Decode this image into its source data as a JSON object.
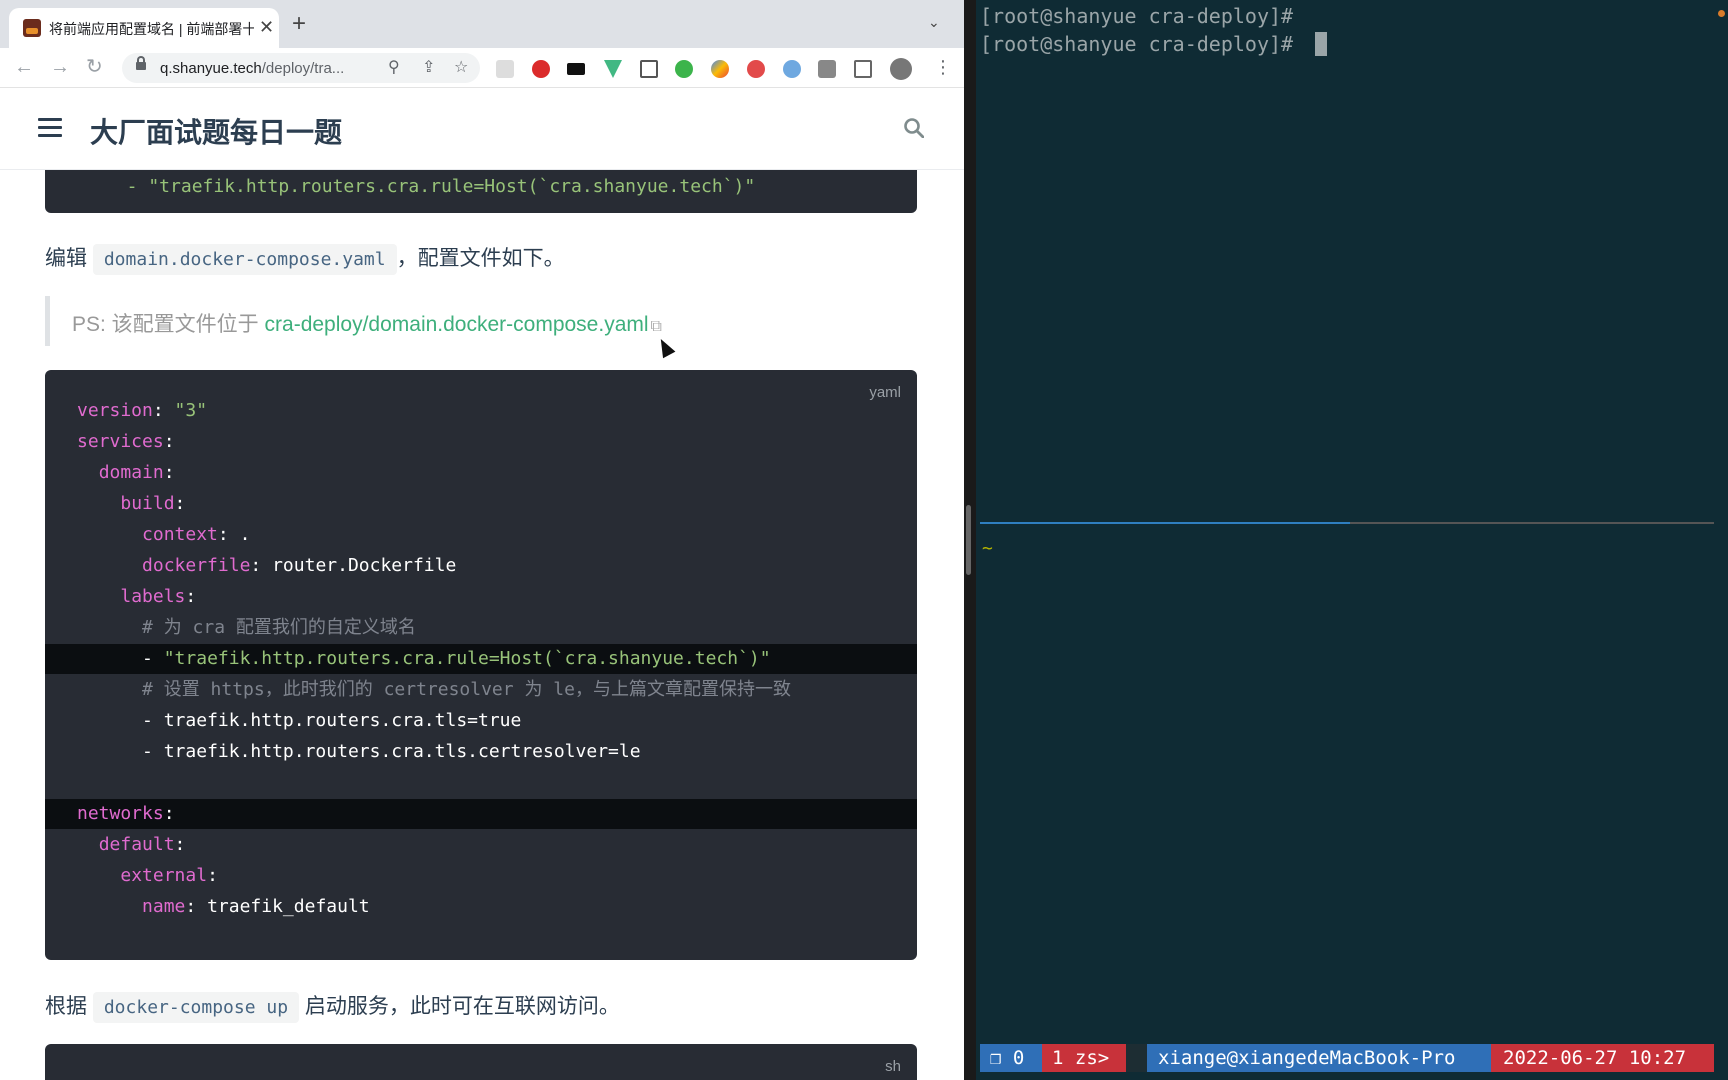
{
  "browser": {
    "tab": {
      "title": "将前端应用配置域名 | 前端部署十",
      "close": "✕"
    },
    "new_tab": "+",
    "tab_menu": "⌄",
    "nav": {
      "back": "←",
      "forward": "→",
      "reload": "↻"
    },
    "url": {
      "host": "q.shanyue.tech",
      "path": "/deploy/tra..."
    },
    "omnibox_icons": {
      "zoom": "⚲",
      "share": "⇪",
      "bookmark": "☆"
    },
    "menu": "⋮"
  },
  "site": {
    "title": "大厂面试题每日一题"
  },
  "article": {
    "top_code_line": "  - \"traefik.http.routers.cra.rule=Host(`cra.shanyue.tech`)\"",
    "para1": {
      "before": "编辑 ",
      "code": "domain.docker-compose.yaml",
      "after": "，配置文件如下。"
    },
    "tip": {
      "prefix": "PS: 该配置文件位于 ",
      "link": "cra-deploy/domain.docker-compose.yaml",
      "external_icon": "⧉"
    },
    "yaml_block": {
      "lang": "yaml",
      "lines": [
        {
          "indent": "",
          "key": "version",
          "sep": ": ",
          "val": "\"3\"",
          "val_type": "s"
        },
        {
          "indent": "",
          "key": "services",
          "sep": ":",
          "val": "",
          "val_type": ""
        },
        {
          "indent": "  ",
          "key": "domain",
          "sep": ":",
          "val": "",
          "val_type": ""
        },
        {
          "indent": "    ",
          "key": "build",
          "sep": ":",
          "val": "",
          "val_type": ""
        },
        {
          "indent": "      ",
          "key": "context",
          "sep": ": ",
          "val": ".",
          "val_type": ""
        },
        {
          "indent": "      ",
          "key": "dockerfile",
          "sep": ": ",
          "val": "router.Dockerfile",
          "val_type": ""
        },
        {
          "indent": "    ",
          "key": "labels",
          "sep": ":",
          "val": "",
          "val_type": ""
        },
        {
          "indent": "      ",
          "key": "",
          "sep": "",
          "val": "# 为 cra 配置我们的自定义域名",
          "val_type": "c"
        },
        {
          "indent": "      ",
          "key": "",
          "sep": "- ",
          "val": "\"traefik.http.routers.cra.rule=Host(`cra.shanyue.tech`)\"",
          "val_type": "s",
          "highlight": true
        },
        {
          "indent": "      ",
          "key": "",
          "sep": "",
          "val": "# 设置 https，此时我们的 certresolver 为 le，与上篇文章配置保持一致",
          "val_type": "c"
        },
        {
          "indent": "      ",
          "key": "",
          "sep": "- ",
          "val": "traefik.http.routers.cra.tls=true",
          "val_type": ""
        },
        {
          "indent": "      ",
          "key": "",
          "sep": "- ",
          "val": "traefik.http.routers.cra.tls.certresolver=le",
          "val_type": ""
        },
        {
          "indent": "",
          "key": "",
          "sep": "",
          "val": "",
          "val_type": ""
        },
        {
          "indent": "",
          "key": "networks",
          "sep": ":",
          "val": "",
          "val_type": "",
          "highlight": true
        },
        {
          "indent": "  ",
          "key": "default",
          "sep": ":",
          "val": "",
          "val_type": ""
        },
        {
          "indent": "    ",
          "key": "external",
          "sep": ":",
          "val": "",
          "val_type": ""
        },
        {
          "indent": "      ",
          "key": "name",
          "sep": ": ",
          "val": "traefik_default",
          "val_type": ""
        }
      ]
    },
    "para2": {
      "before": "根据 ",
      "code": "docker-compose up",
      "after": " 启动服务，此时可在互联网访问。"
    },
    "sh_block": {
      "lang": "sh"
    }
  },
  "terminal": {
    "lines": [
      "[root@shanyue cra-deploy]#",
      "[root@shanyue cra-deploy]# "
    ],
    "lower_pane": "~",
    "status": {
      "window": "❐ 0",
      "session": "1 zs>",
      "host": "xiange@xiangedeMacBook-Pro",
      "datetime": "2022-06-27 10:27"
    },
    "colors": {
      "window_bg": "#2f6fb7",
      "session_bg": "#c8323a",
      "host_bg": "#2f6fb7",
      "datetime_bg": "#c8323a"
    }
  }
}
